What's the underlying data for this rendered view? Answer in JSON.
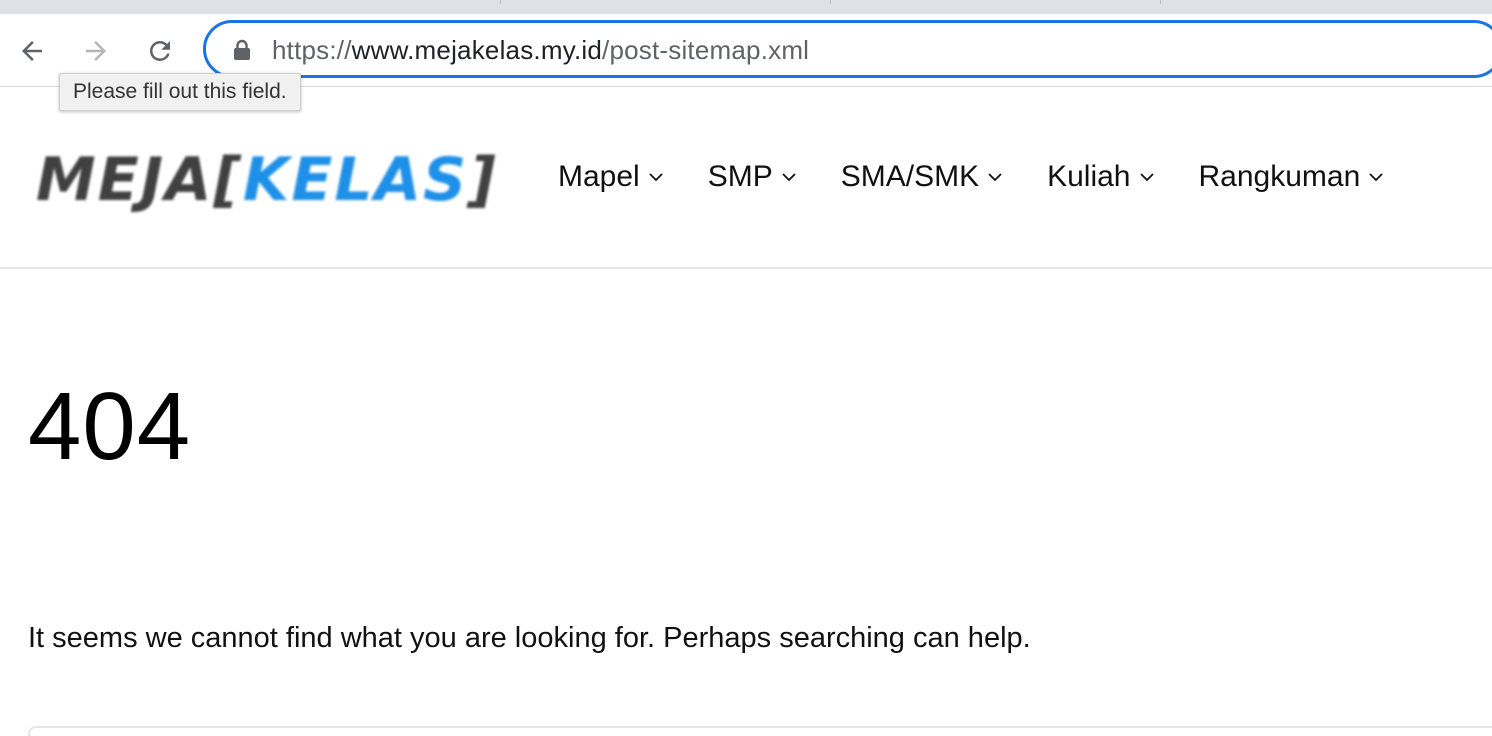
{
  "browser": {
    "url_scheme": "https://",
    "url_host": "www.mejakelas.my.id",
    "url_path": "/post-sitemap.xml",
    "tooltip": "Please fill out this field.",
    "icons": {
      "back": "back-arrow-icon",
      "forward": "forward-arrow-icon",
      "reload": "reload-icon",
      "lock": "lock-icon"
    },
    "accent_color": "#1a73e8"
  },
  "site": {
    "logo": {
      "part1": "MEJA[",
      "part2": "KELAS",
      "part3": "]",
      "colors": {
        "dark": "#404040",
        "blue": "#1e90e8"
      }
    },
    "menu": [
      {
        "label": "Mapel"
      },
      {
        "label": "SMP"
      },
      {
        "label": "SMA/SMK"
      },
      {
        "label": "Kuliah"
      },
      {
        "label": "Rangkuman"
      }
    ]
  },
  "content": {
    "title": "404",
    "message": "It seems we cannot find what you are looking for. Perhaps searching can help."
  }
}
